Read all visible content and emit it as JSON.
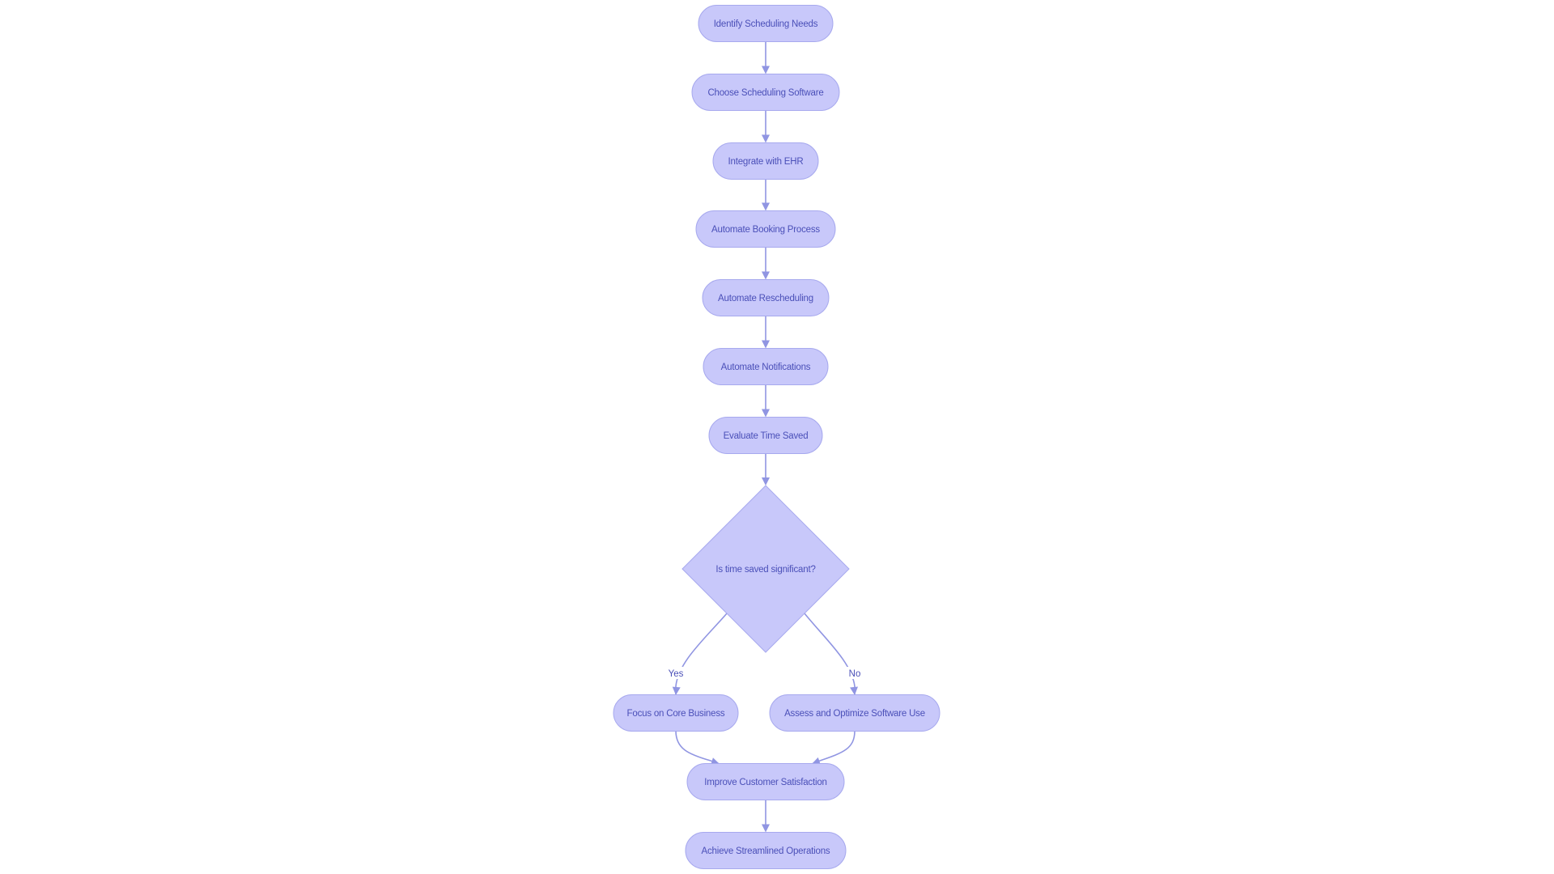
{
  "diagram": {
    "type": "flowchart",
    "direction": "top-down",
    "colors": {
      "node_fill": "#c8c8fa",
      "node_border": "#a7a9ee",
      "edge": "#9095e2",
      "text": "#4a4fb8",
      "background": "#ffffff"
    },
    "nodes": [
      {
        "id": "identify",
        "label": "Identify Scheduling Needs",
        "shape": "stadium"
      },
      {
        "id": "choose",
        "label": "Choose Scheduling Software",
        "shape": "stadium"
      },
      {
        "id": "integrate",
        "label": "Integrate with EHR",
        "shape": "stadium"
      },
      {
        "id": "booking",
        "label": "Automate Booking Process",
        "shape": "stadium"
      },
      {
        "id": "reschedule",
        "label": "Automate Rescheduling",
        "shape": "stadium"
      },
      {
        "id": "notify",
        "label": "Automate Notifications",
        "shape": "stadium"
      },
      {
        "id": "evaluate",
        "label": "Evaluate Time Saved",
        "shape": "stadium"
      },
      {
        "id": "decision",
        "label": "Is time saved significant?",
        "shape": "diamond"
      },
      {
        "id": "focus",
        "label": "Focus on Core Business",
        "shape": "stadium"
      },
      {
        "id": "assess",
        "label": "Assess and Optimize Software Use",
        "shape": "stadium"
      },
      {
        "id": "improve",
        "label": "Improve Customer Satisfaction",
        "shape": "stadium"
      },
      {
        "id": "achieve",
        "label": "Achieve Streamlined Operations",
        "shape": "stadium"
      }
    ],
    "edges": [
      {
        "from": "identify",
        "to": "choose",
        "label": ""
      },
      {
        "from": "choose",
        "to": "integrate",
        "label": ""
      },
      {
        "from": "integrate",
        "to": "booking",
        "label": ""
      },
      {
        "from": "booking",
        "to": "reschedule",
        "label": ""
      },
      {
        "from": "reschedule",
        "to": "notify",
        "label": ""
      },
      {
        "from": "notify",
        "to": "evaluate",
        "label": ""
      },
      {
        "from": "evaluate",
        "to": "decision",
        "label": ""
      },
      {
        "from": "decision",
        "to": "focus",
        "label": "Yes"
      },
      {
        "from": "decision",
        "to": "assess",
        "label": "No"
      },
      {
        "from": "focus",
        "to": "improve",
        "label": ""
      },
      {
        "from": "assess",
        "to": "improve",
        "label": ""
      },
      {
        "from": "improve",
        "to": "achieve",
        "label": ""
      }
    ]
  }
}
